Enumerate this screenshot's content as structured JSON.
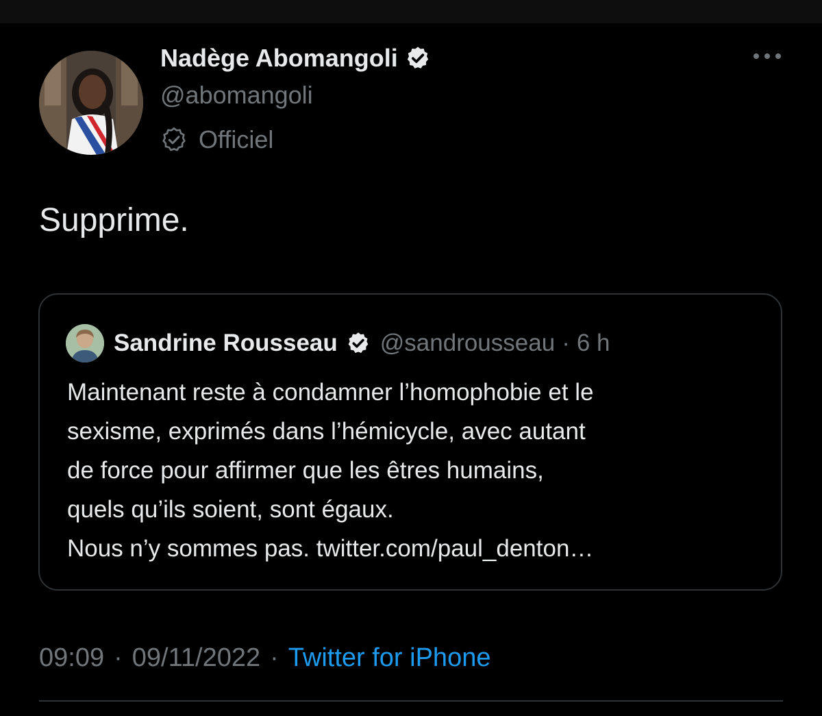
{
  "author": {
    "display_name": "Nadège Abomangoli",
    "handle": "@abomangoli",
    "label": "Officiel"
  },
  "tweet": {
    "text": "Supprime."
  },
  "quoted_tweet": {
    "display_name": "Sandrine Rousseau",
    "handle": "@sandrousseau",
    "separator": "·",
    "time": "6 h",
    "lines": [
      "Maintenant reste à condamner l’homophobie et le",
      "sexisme, exprimés dans l’hémicycle, avec autant",
      "de force pour affirmer que les êtres humains,",
      "quels qu’ils soient, sont égaux.",
      "Nous n’y sommes pas. twitter.com/paul_denton…"
    ]
  },
  "meta": {
    "time": "09:09",
    "separator": "·",
    "date": "09/11/2022",
    "source": "Twitter for iPhone"
  },
  "colors": {
    "background": "#000000",
    "primary_text": "#e7e9ea",
    "secondary_text": "#71767b",
    "link": "#1d9bf0",
    "border": "#2f3336"
  },
  "icons": {
    "verified": "verified-badge-icon",
    "official": "official-badge-icon",
    "more": "more-dots-icon"
  }
}
